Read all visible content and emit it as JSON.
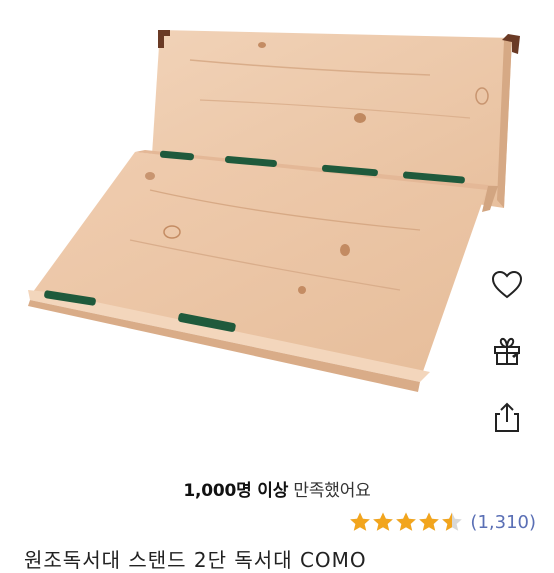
{
  "image": {
    "alt": "원목 독서대 스탠드 2단"
  },
  "actions": {
    "wishlist_icon": "heart-icon",
    "gift_icon": "gift-icon",
    "share_icon": "share-icon"
  },
  "satisfaction": {
    "count": "1,000명 이상",
    "suffix": "만족했어요"
  },
  "rating": {
    "value": 4.5,
    "max": 5,
    "review_count": "(1,310)",
    "star_color": "#f2a51d",
    "empty_color": "#d8d8d8"
  },
  "product": {
    "title_partial": "원조독서대 스탠드 2단 독서대 COMO"
  },
  "colors": {
    "wood": "#ecc7a8",
    "strap": "#1f5a3c",
    "link": "#5a6fb5"
  }
}
